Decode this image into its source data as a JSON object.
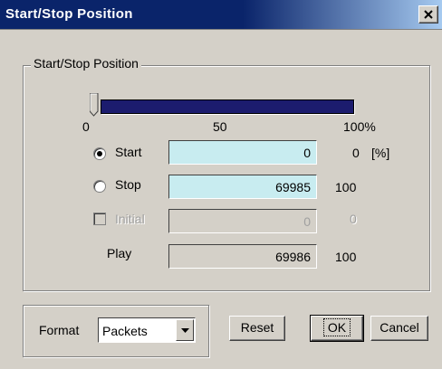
{
  "window": {
    "title": "Start/Stop Position"
  },
  "group": {
    "label": "Start/Stop Position"
  },
  "slider": {
    "tick_min": "0",
    "tick_mid": "50",
    "tick_max": "100%",
    "start_percent": 0,
    "stop_percent": 100,
    "accent_color": "#1c1c6e"
  },
  "rows": {
    "start": {
      "label": "Start",
      "value": "0",
      "percent": "0",
      "unit": "[%]",
      "selected": true
    },
    "stop": {
      "label": "Stop",
      "value": "69985",
      "percent": "100",
      "selected": false
    },
    "initial": {
      "label": "Initial",
      "value": "0",
      "percent": "0",
      "checked": false,
      "enabled": false
    },
    "play": {
      "label": "Play",
      "value": "69986",
      "percent": "100"
    }
  },
  "format": {
    "label": "Format",
    "selected": "Packets"
  },
  "buttons": {
    "reset": "Reset",
    "ok": "OK",
    "cancel": "Cancel"
  },
  "icons": {
    "close": "close-icon",
    "dropdown": "chevron-down-icon"
  }
}
